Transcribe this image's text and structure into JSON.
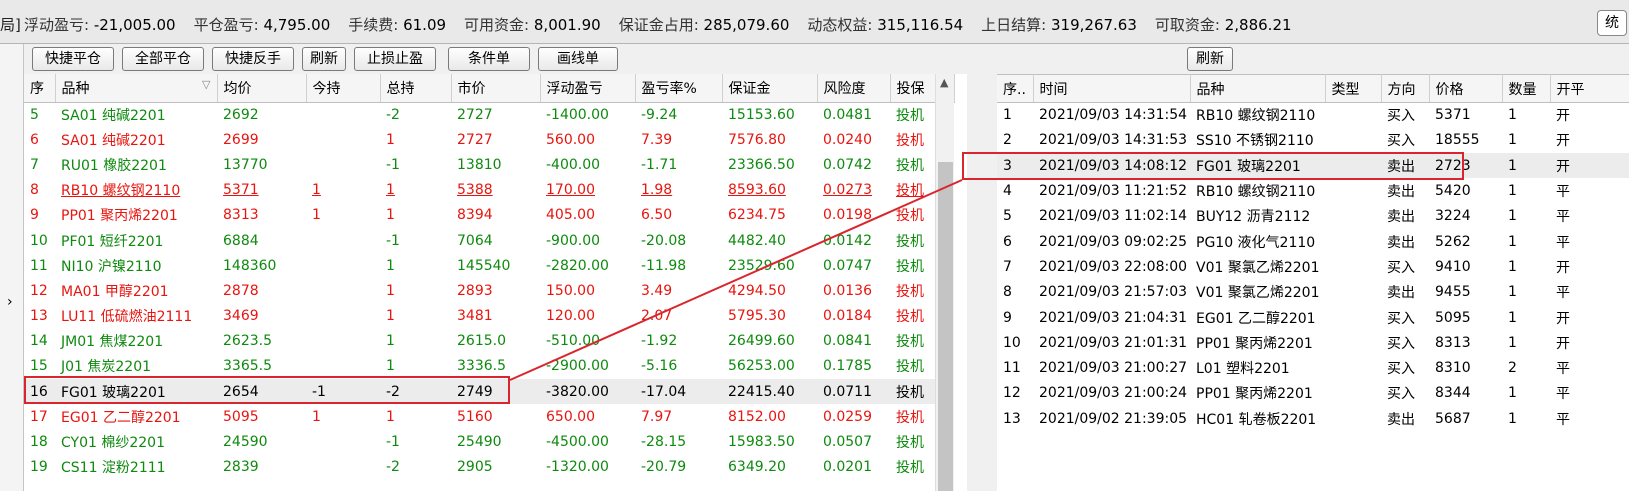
{
  "topbar": {
    "edge_glyph": "局]",
    "stats": [
      {
        "label": "浮动盈亏:",
        "value": "-21,005.00"
      },
      {
        "label": "平仓盈亏:",
        "value": "4,795.00"
      },
      {
        "label": "手续费:",
        "value": "61.09"
      },
      {
        "label": "可用资金:",
        "value": "8,001.90"
      },
      {
        "label": "保证金占用:",
        "value": "285,079.60"
      },
      {
        "label": "动态权益:",
        "value": "315,116.54"
      },
      {
        "label": "上日结算:",
        "value": "319,267.63"
      },
      {
        "label": "可取资金:",
        "value": "2,886.21"
      }
    ],
    "right_button": "统"
  },
  "positions": {
    "buttons": {
      "quick_close": "快捷平仓",
      "close_all": "全部平仓",
      "quick_reverse": "快捷反手",
      "refresh": "刷新",
      "stop": "止损止盈",
      "conditional": "条件单",
      "line_order": "画线单"
    },
    "columns": {
      "seq": "序",
      "symbol": "品种",
      "avg": "均价",
      "today": "今持",
      "total": "总持",
      "price": "市价",
      "pnl": "浮动盈亏",
      "rate": "盈亏率%",
      "margin": "保证金",
      "risk": "风险度",
      "hedge": "投保"
    },
    "sort_mark": "▽",
    "rows": [
      {
        "seq": "5",
        "symbol": "SA01 纯碱2201",
        "avg": "2692",
        "today": "",
        "total": "-2",
        "price": "2727",
        "pnl": "-1400.00",
        "rate": "-9.24",
        "margin": "15153.60",
        "risk": "0.0481",
        "hedge": "投机"
      },
      {
        "seq": "6",
        "symbol": "SA01 纯碱2201",
        "avg": "2699",
        "today": "",
        "total": "1",
        "price": "2727",
        "pnl": "560.00",
        "rate": "7.39",
        "margin": "7576.80",
        "risk": "0.0240",
        "hedge": "投机"
      },
      {
        "seq": "7",
        "symbol": "RU01 橡胶2201",
        "avg": "13770",
        "today": "",
        "total": "-1",
        "price": "13810",
        "pnl": "-400.00",
        "rate": "-1.71",
        "margin": "23366.50",
        "risk": "0.0742",
        "hedge": "投机"
      },
      {
        "seq": "8",
        "symbol": "RB10 螺纹钢2110",
        "avg": "5371",
        "today": "1",
        "total": "1",
        "price": "5388",
        "pnl": "170.00",
        "rate": "1.98",
        "margin": "8593.60",
        "risk": "0.0273",
        "hedge": "投机"
      },
      {
        "seq": "9",
        "symbol": "PP01 聚丙烯2201",
        "avg": "8313",
        "today": "1",
        "total": "1",
        "price": "8394",
        "pnl": "405.00",
        "rate": "6.50",
        "margin": "6234.75",
        "risk": "0.0198",
        "hedge": "投机"
      },
      {
        "seq": "10",
        "symbol": "PF01 短纤2201",
        "avg": "6884",
        "today": "",
        "total": "-1",
        "price": "7064",
        "pnl": "-900.00",
        "rate": "-20.08",
        "margin": "4482.40",
        "risk": "0.0142",
        "hedge": "投机"
      },
      {
        "seq": "11",
        "symbol": "NI10 沪镍2110",
        "avg": "148360",
        "today": "",
        "total": "1",
        "price": "145540",
        "pnl": "-2820.00",
        "rate": "-11.98",
        "margin": "23529.60",
        "risk": "0.0747",
        "hedge": "投机"
      },
      {
        "seq": "12",
        "symbol": "MA01 甲醇2201",
        "avg": "2878",
        "today": "",
        "total": "1",
        "price": "2893",
        "pnl": "150.00",
        "rate": "3.49",
        "margin": "4294.50",
        "risk": "0.0136",
        "hedge": "投机"
      },
      {
        "seq": "13",
        "symbol": "LU11 低硫燃油2111",
        "avg": "3469",
        "today": "",
        "total": "1",
        "price": "3481",
        "pnl": "120.00",
        "rate": "2.07",
        "margin": "5795.30",
        "risk": "0.0184",
        "hedge": "投机"
      },
      {
        "seq": "14",
        "symbol": "JM01 焦煤2201",
        "avg": "2623.5",
        "today": "",
        "total": "1",
        "price": "2615.0",
        "pnl": "-510.00",
        "rate": "-1.92",
        "margin": "26499.60",
        "risk": "0.0841",
        "hedge": "投机"
      },
      {
        "seq": "15",
        "symbol": "J01 焦炭2201",
        "avg": "3365.5",
        "today": "",
        "total": "1",
        "price": "3336.5",
        "pnl": "-2900.00",
        "rate": "-5.16",
        "margin": "56253.00",
        "risk": "0.1785",
        "hedge": "投机"
      },
      {
        "seq": "16",
        "symbol": "FG01 玻璃2201",
        "avg": "2654",
        "today": "-1",
        "total": "-2",
        "price": "2749",
        "pnl": "-3820.00",
        "rate": "-17.04",
        "margin": "22415.40",
        "risk": "0.0711",
        "hedge": "投机"
      },
      {
        "seq": "17",
        "symbol": "EG01 乙二醇2201",
        "avg": "5095",
        "today": "1",
        "total": "1",
        "price": "5160",
        "pnl": "650.00",
        "rate": "7.97",
        "margin": "8152.00",
        "risk": "0.0259",
        "hedge": "投机"
      },
      {
        "seq": "18",
        "symbol": "CY01 棉纱2201",
        "avg": "24590",
        "today": "",
        "total": "-1",
        "price": "25490",
        "pnl": "-4500.00",
        "rate": "-28.15",
        "margin": "15983.50",
        "risk": "0.0507",
        "hedge": "投机"
      },
      {
        "seq": "19",
        "symbol": "CS11 淀粉2111",
        "avg": "2839",
        "today": "",
        "total": "-2",
        "price": "2905",
        "pnl": "-1320.00",
        "rate": "-20.79",
        "margin": "6349.20",
        "risk": "0.0201",
        "hedge": "投机"
      }
    ]
  },
  "trades": {
    "refresh": "刷新",
    "columns": {
      "seq": "序..",
      "time": "时间",
      "symbol": "品种",
      "type": "类型",
      "dir": "方向",
      "price": "价格",
      "qty": "数量",
      "oc": "开平"
    },
    "rows": [
      {
        "seq": "1",
        "time": "2021/09/03 14:31:54",
        "symbol": "RB10 螺纹钢2110",
        "type": "",
        "dir": "买入",
        "price": "5371",
        "qty": "1",
        "oc": "开"
      },
      {
        "seq": "2",
        "time": "2021/09/03 14:31:53",
        "symbol": "SS10 不锈钢2110",
        "type": "",
        "dir": "买入",
        "price": "18555",
        "qty": "1",
        "oc": "开"
      },
      {
        "seq": "3",
        "time": "2021/09/03 14:08:12",
        "symbol": "FG01 玻璃2201",
        "type": "",
        "dir": "卖出",
        "price": "2723",
        "qty": "1",
        "oc": "开"
      },
      {
        "seq": "4",
        "time": "2021/09/03 11:21:52",
        "symbol": "RB10 螺纹钢2110",
        "type": "",
        "dir": "卖出",
        "price": "5420",
        "qty": "1",
        "oc": "平"
      },
      {
        "seq": "5",
        "time": "2021/09/03 11:02:14",
        "symbol": "BUY12 沥青2112",
        "type": "",
        "dir": "卖出",
        "price": "3224",
        "qty": "1",
        "oc": "平"
      },
      {
        "seq": "6",
        "time": "2021/09/03 09:02:25",
        "symbol": "PG10 液化气2110",
        "type": "",
        "dir": "卖出",
        "price": "5262",
        "qty": "1",
        "oc": "平"
      },
      {
        "seq": "7",
        "time": "2021/09/03 22:08:00",
        "symbol": "V01 聚氯乙烯2201",
        "type": "",
        "dir": "买入",
        "price": "9410",
        "qty": "1",
        "oc": "开"
      },
      {
        "seq": "8",
        "time": "2021/09/03 21:57:03",
        "symbol": "V01 聚氯乙烯2201",
        "type": "",
        "dir": "卖出",
        "price": "9455",
        "qty": "1",
        "oc": "平"
      },
      {
        "seq": "9",
        "time": "2021/09/03 21:04:31",
        "symbol": "EG01 乙二醇2201",
        "type": "",
        "dir": "买入",
        "price": "5095",
        "qty": "1",
        "oc": "开"
      },
      {
        "seq": "10",
        "time": "2021/09/03 21:01:31",
        "symbol": "PP01 聚丙烯2201",
        "type": "",
        "dir": "买入",
        "price": "8313",
        "qty": "1",
        "oc": "开"
      },
      {
        "seq": "11",
        "time": "2021/09/03 21:00:27",
        "symbol": "L01 塑料2201",
        "type": "",
        "dir": "买入",
        "price": "8310",
        "qty": "2",
        "oc": "平"
      },
      {
        "seq": "12",
        "time": "2021/09/03 21:00:24",
        "symbol": "PP01 聚丙烯2201",
        "type": "",
        "dir": "买入",
        "price": "8344",
        "qty": "1",
        "oc": "平"
      },
      {
        "seq": "13",
        "time": "2021/09/02 21:39:05",
        "symbol": "HC01 轧卷板2201",
        "type": "",
        "dir": "卖出",
        "price": "5687",
        "qty": "1",
        "oc": "平"
      }
    ]
  },
  "colors": {
    "profit": "#e8150f",
    "loss": "#0e8a0e",
    "highlight": "#d9252c"
  }
}
